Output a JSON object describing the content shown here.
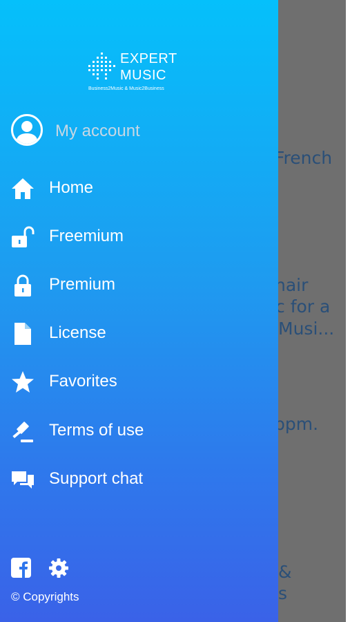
{
  "logo": {
    "line1": "EXPERT",
    "line2": "MUSIC",
    "tagline": "Business2Music & Music2Business"
  },
  "account": {
    "label": "My account",
    "icon": "user-avatar-icon"
  },
  "menu": [
    {
      "label": "Home",
      "icon": "home-icon"
    },
    {
      "label": "Freemium",
      "icon": "unlocked-padlock-icon"
    },
    {
      "label": "Premium",
      "icon": "locked-padlock-icon"
    },
    {
      "label": "License",
      "icon": "document-icon"
    },
    {
      "label": "Favorites",
      "icon": "star-icon"
    },
    {
      "label": "Terms of use",
      "icon": "gavel-icon"
    },
    {
      "label": "Support chat",
      "icon": "chat-bubbles-icon"
    }
  ],
  "footer": {
    "facebook_icon": "facebook-icon",
    "settings_icon": "gear-icon",
    "copyright": "© Copyrights"
  },
  "background": {
    "lines": [
      "French",
      "hair",
      "c for a",
      "Musi...",
      "ppm.",
      "&",
      "s"
    ]
  },
  "colors": {
    "drawer_top": "#05c0fb",
    "drawer_bottom": "#3a62e8",
    "overlay": "#6f6f6f",
    "background_text": "#2a4f78"
  }
}
